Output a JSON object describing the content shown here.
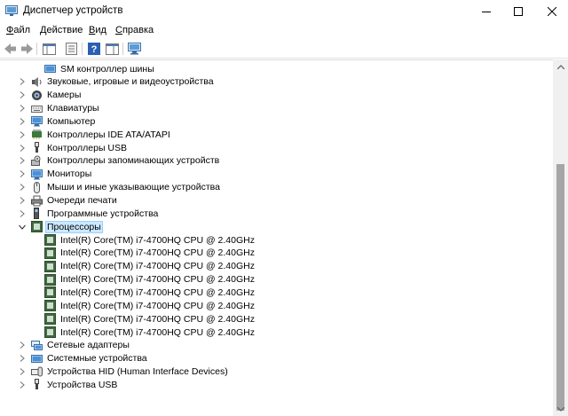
{
  "window": {
    "title": "Диспетчер устройств"
  },
  "menu": [
    {
      "label": "Файл",
      "mnemonic": "Ф",
      "rest": "айл"
    },
    {
      "label": "Действие",
      "mnemonic": "Д",
      "rest": "ействие"
    },
    {
      "label": "Вид",
      "mnemonic": "В",
      "rest": "ид"
    },
    {
      "label": "Справка",
      "mnemonic": "С",
      "rest": "правка"
    }
  ],
  "tree": {
    "partial_item": "SM контроллер шины",
    "categories_before": [
      {
        "label": "Звуковые, игровые и видеоустройства",
        "icon": "speaker-icon"
      },
      {
        "label": "Камеры",
        "icon": "camera-icon"
      },
      {
        "label": "Клавиатуры",
        "icon": "keyboard-icon"
      },
      {
        "label": "Компьютер",
        "icon": "monitor-icon"
      },
      {
        "label": "Контроллеры IDE ATA/ATAPI",
        "icon": "ide-controller-icon"
      },
      {
        "label": "Контроллеры USB",
        "icon": "usb-icon"
      },
      {
        "label": "Контроллеры запоминающих устройств",
        "icon": "storage-controller-icon"
      },
      {
        "label": "Мониторы",
        "icon": "monitor-icon"
      },
      {
        "label": "Мыши и иные указывающие устройства",
        "icon": "mouse-icon"
      },
      {
        "label": "Очереди печати",
        "icon": "printer-icon"
      },
      {
        "label": "Программные устройства",
        "icon": "software-device-icon"
      }
    ],
    "expanded_category": {
      "label": "Процессоры",
      "icon": "processor-icon"
    },
    "processors": [
      "Intel(R) Core(TM) i7-4700HQ CPU @ 2.40GHz",
      "Intel(R) Core(TM) i7-4700HQ CPU @ 2.40GHz",
      "Intel(R) Core(TM) i7-4700HQ CPU @ 2.40GHz",
      "Intel(R) Core(TM) i7-4700HQ CPU @ 2.40GHz",
      "Intel(R) Core(TM) i7-4700HQ CPU @ 2.40GHz",
      "Intel(R) Core(TM) i7-4700HQ CPU @ 2.40GHz",
      "Intel(R) Core(TM) i7-4700HQ CPU @ 2.40GHz",
      "Intel(R) Core(TM) i7-4700HQ CPU @ 2.40GHz"
    ],
    "categories_after": [
      {
        "label": "Сетевые адаптеры",
        "icon": "network-icon"
      },
      {
        "label": "Системные устройства",
        "icon": "system-device-icon"
      },
      {
        "label": "Устройства HID (Human Interface Devices)",
        "icon": "hid-icon"
      },
      {
        "label": "Устройства USB",
        "icon": "usb-icon"
      }
    ]
  },
  "colors": {
    "selection": "#cce8ff",
    "scroll_thumb": "#a6a6a6"
  }
}
